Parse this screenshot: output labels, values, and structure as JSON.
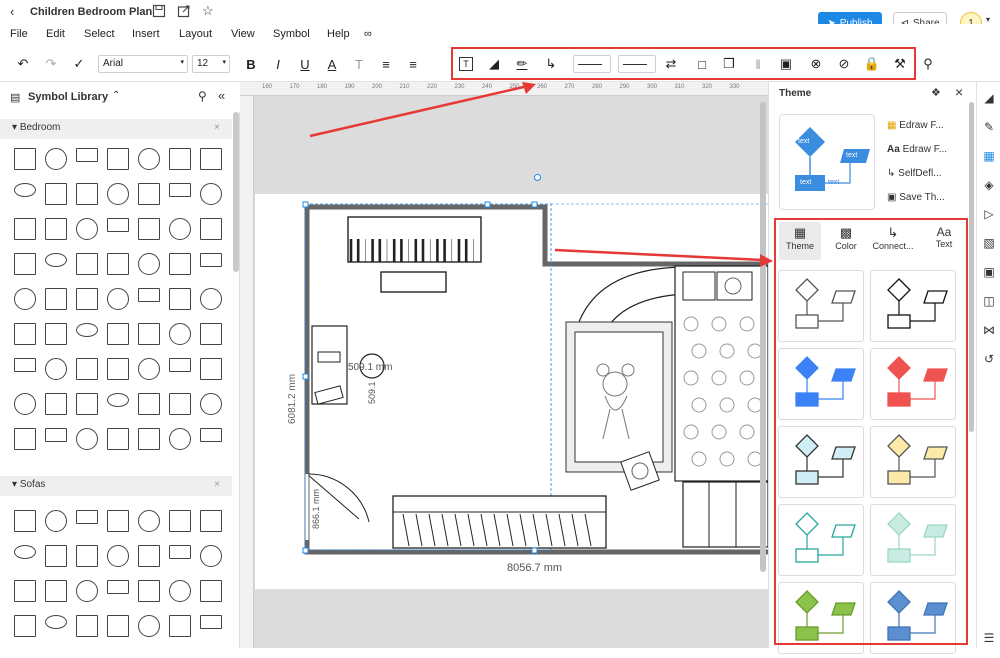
{
  "title": {
    "doc_name": "Children Bedroom Plan"
  },
  "actions": {
    "publish": "Publish",
    "share": "Share",
    "user_badge": "1"
  },
  "menu": [
    "File",
    "Edit",
    "Select",
    "Insert",
    "Layout",
    "View",
    "Symbol",
    "Help"
  ],
  "toolbar": {
    "font": "Arial",
    "size": "12"
  },
  "library": {
    "title": "Symbol Library",
    "sections": [
      {
        "name": "Bedroom"
      },
      {
        "name": "Sofas"
      }
    ]
  },
  "ruler": {
    "ticks": [
      "160",
      "170",
      "180",
      "190",
      "200",
      "210",
      "220",
      "230",
      "240",
      "250",
      "260",
      "270",
      "280",
      "290",
      "300",
      "310",
      "320",
      "330"
    ]
  },
  "canvas": {
    "dim_width": "8056.7 mm",
    "dim_height": "6081.2 mm",
    "dim_chair_w": "509.1 mm",
    "dim_chair_h": "509.1",
    "dim_door": "866.1 mm"
  },
  "theme_panel": {
    "title": "Theme",
    "options": [
      "Edraw F...",
      "Edraw F...",
      "SelfDefl...",
      "Save Th..."
    ],
    "preview_labels": [
      "text",
      "text",
      "text",
      "text"
    ],
    "tabs": [
      "Theme",
      "Color",
      "Connect...",
      "Text"
    ],
    "cards": [
      {
        "fill": "#ffffff",
        "stroke": "#555555"
      },
      {
        "fill": "#ffffff",
        "stroke": "#111111"
      },
      {
        "fill": "#3b82f6",
        "stroke": "#3b82f6"
      },
      {
        "fill": "#ef5350",
        "stroke": "#ef5350"
      },
      {
        "fill": "#cfeef5",
        "stroke": "#333333"
      },
      {
        "fill": "#fde9a8",
        "stroke": "#555555"
      },
      {
        "fill": "#ffffff",
        "stroke": "#26a69a"
      },
      {
        "fill": "#c8ebe2",
        "stroke": "#9ad6c6"
      },
      {
        "fill": "#8bc34a",
        "stroke": "#6a9c2d"
      },
      {
        "fill": "#5b8fd0",
        "stroke": "#3f74b8"
      }
    ]
  },
  "colors": {
    "accent": "#1e88e5",
    "highlight_box": "#e53935",
    "arrow": "#e53935"
  }
}
